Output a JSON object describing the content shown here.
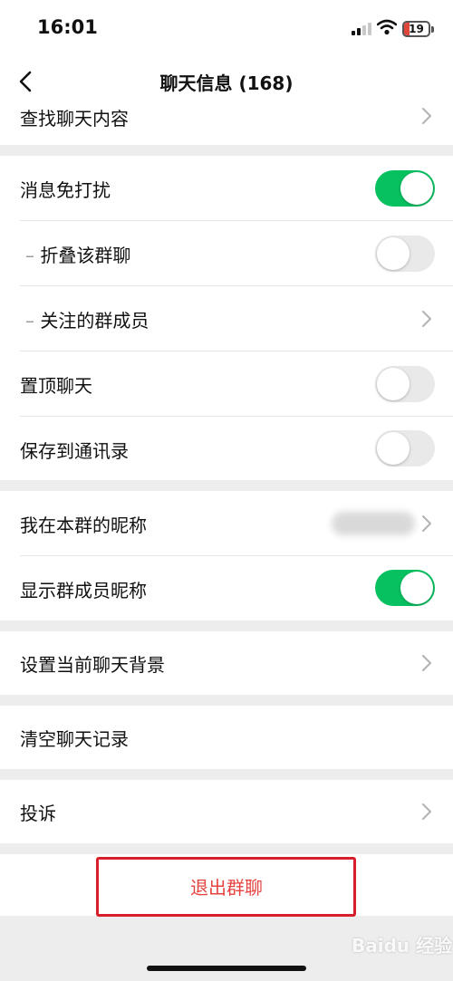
{
  "status_bar": {
    "time": "16:01",
    "battery_level": "19",
    "icons": [
      "cellular-signal-icon",
      "wifi-icon",
      "battery-icon"
    ]
  },
  "header": {
    "title": "聊天信息 (168)",
    "back_icon": "chevron-left-icon"
  },
  "settings": {
    "find_content": "查找聊天内容",
    "mute_notifications": {
      "label": "消息免打扰",
      "enabled": true
    },
    "fold_group": {
      "label": "折叠该群聊",
      "enabled": false
    },
    "followed_members": "关注的群成员",
    "pin_chat": {
      "label": "置顶聊天",
      "enabled": false
    },
    "save_to_contacts": {
      "label": "保存到通讯录",
      "enabled": false
    },
    "my_group_nickname": "我在本群的昵称",
    "show_member_nicknames": {
      "label": "显示群成员昵称",
      "enabled": true
    },
    "set_background": "设置当前聊天背景",
    "clear_history": "清空聊天记录",
    "report": "投诉",
    "exit_group": "退出群聊"
  },
  "watermark": "Baidu 经验",
  "colors": {
    "toggle_on": "#07c160",
    "toggle_off": "#e9e9ea",
    "danger_text": "#e64340",
    "highlight_box": "#d81e2a",
    "background": "#ededed"
  }
}
